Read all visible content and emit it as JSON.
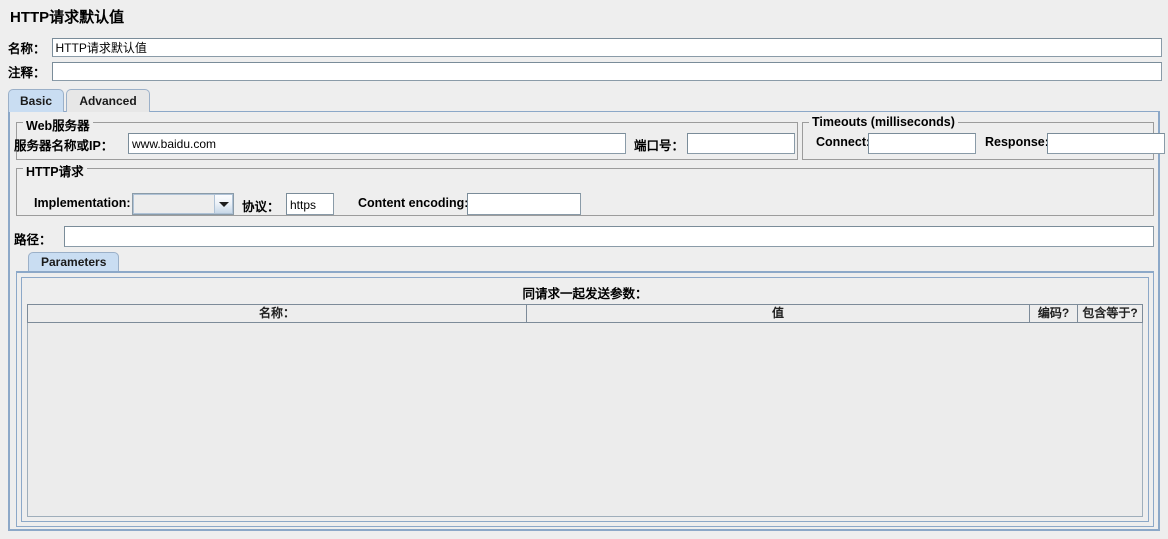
{
  "page_title": "HTTP请求默认值",
  "form": {
    "name_label": "名称：",
    "name_value": "HTTP请求默认值",
    "comment_label": "注释：",
    "comment_value": ""
  },
  "tabs": [
    {
      "label": "Basic",
      "selected": true
    },
    {
      "label": "Advanced",
      "selected": false
    }
  ],
  "web_server": {
    "group_title": "Web服务器",
    "server_label": "服务器名称或IP：",
    "server_value": "www.baidu.com",
    "port_label": "端口号：",
    "port_value": ""
  },
  "timeouts": {
    "group_title": "Timeouts (milliseconds)",
    "connect_label": "Connect:",
    "connect_value": "",
    "response_label": "Response:",
    "response_value": ""
  },
  "http_request": {
    "group_title": "HTTP请求",
    "implementation_label": "Implementation:",
    "implementation_value": "",
    "protocol_label": "协议：",
    "protocol_value": "https",
    "content_encoding_label": "Content encoding:",
    "content_encoding_value": ""
  },
  "path": {
    "label": "路径：",
    "value": ""
  },
  "parameters": {
    "tab_label": "Parameters",
    "caption": "同请求一起发送参数：",
    "columns": [
      "名称：",
      "值",
      "编码?",
      "包含等于?"
    ],
    "rows": []
  },
  "icons": {
    "combo_arrow": "chevron-down-icon"
  },
  "colors": {
    "background": "#EEEEEE",
    "tab_selected": "#C9DDF2",
    "tab_unselected": "#E7E7E7",
    "panel_border": "#8CA8C8",
    "field_border": "#8A9BA8",
    "field_background": "#FFFFFF"
  }
}
